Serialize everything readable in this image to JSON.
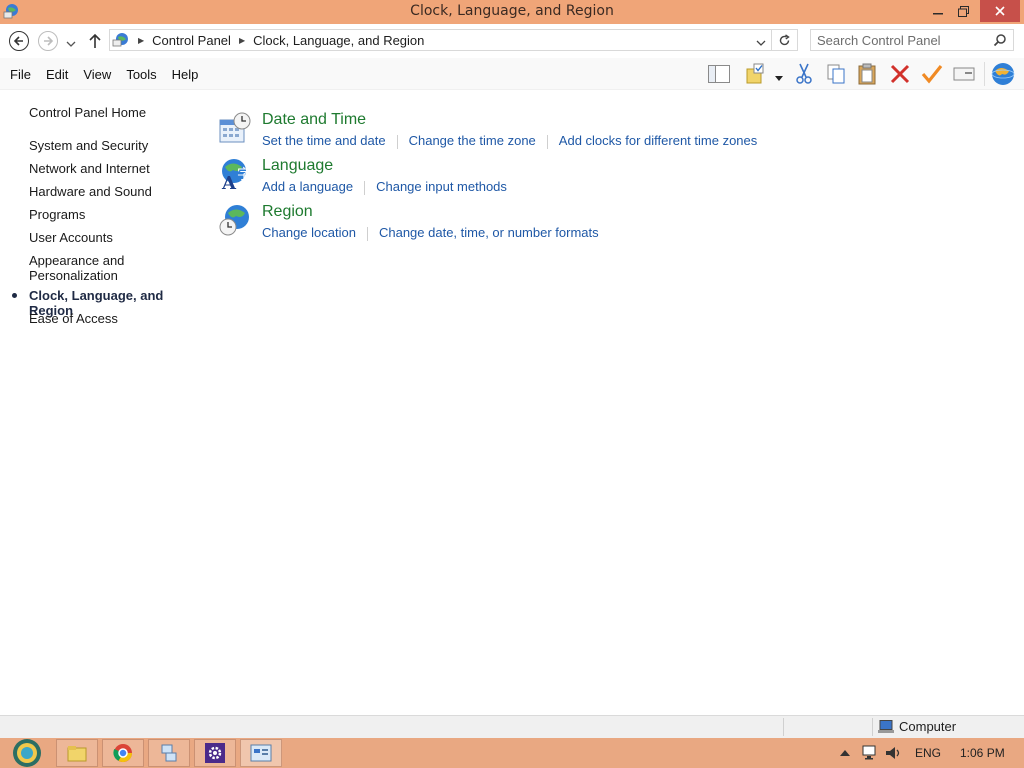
{
  "window": {
    "title": "Clock, Language, and Region",
    "controls": {
      "minimize": "–",
      "maximize": "❐",
      "close": "✕"
    }
  },
  "address": {
    "crumbs": [
      "Control Panel",
      "Clock, Language, and Region"
    ],
    "search_placeholder": "Search Control Panel"
  },
  "menu": [
    "File",
    "Edit",
    "View",
    "Tools",
    "Help"
  ],
  "toolbar": [
    "pane-icon",
    "folder-check-icon",
    "cut-icon",
    "copy-icon",
    "paste-icon",
    "delete-icon",
    "checkmark-icon",
    "properties-icon",
    "globe-icon"
  ],
  "leftnav": {
    "home": "Control Panel Home",
    "items": [
      "System and Security",
      "Network and Internet",
      "Hardware and Sound",
      "Programs",
      "User Accounts",
      "Appearance and Personalization",
      "Clock, Language, and Region",
      "Ease of Access"
    ],
    "current": "Clock, Language, and Region"
  },
  "categories": [
    {
      "title": "Date and Time",
      "icon": "calendar-clock-icon",
      "links": [
        "Set the time and date",
        "Change the time zone",
        "Add clocks for different time zones"
      ]
    },
    {
      "title": "Language",
      "icon": "language-globe-icon",
      "links": [
        "Add a language",
        "Change input methods"
      ]
    },
    {
      "title": "Region",
      "icon": "region-globe-clock-icon",
      "links": [
        "Change location",
        "Change date, time, or number formats"
      ]
    }
  ],
  "status": {
    "location": "Computer"
  },
  "taskbar": {
    "apps": [
      "file-explorer-icon",
      "chrome-icon",
      "network-app-icon",
      "settings-app-icon",
      "control-panel-icon"
    ],
    "language": "ENG",
    "time": "1:06 PM"
  },
  "colors": {
    "titlebar": "#f0a578",
    "taskbar": "#e9a882",
    "heading": "#1e7a2f",
    "link": "#1f58a6",
    "close": "#c7504a"
  }
}
